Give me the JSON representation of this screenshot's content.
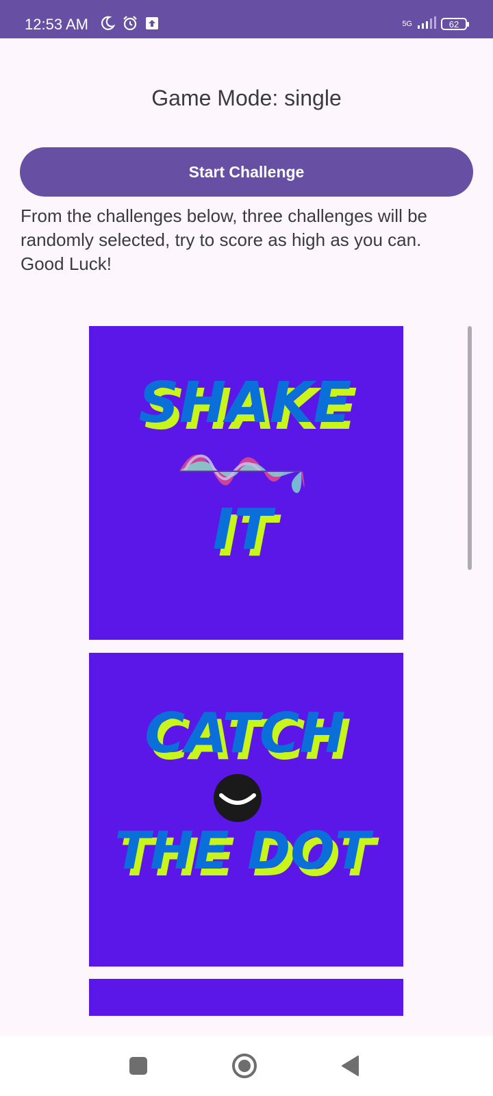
{
  "status_bar": {
    "time": "12:53 AM",
    "network": "5G",
    "battery": "62",
    "icons": [
      "moon-icon",
      "alarm-icon",
      "upload-icon",
      "signal-icon",
      "battery-icon"
    ]
  },
  "game_mode_text": "Game Mode: single",
  "start_button_label": "Start Challenge",
  "instructions": {
    "line1": "From the challenges below, three challenges will be randomly selected, try to score as high as you can.",
    "line2": "Good Luck!"
  },
  "challenges": [
    {
      "line1": "SHAKE",
      "line2": "IT"
    },
    {
      "line1": "CATCH",
      "line2": "THE DOT"
    }
  ],
  "colors": {
    "primary": "#6750a4",
    "card_bg": "#5b17e8",
    "title_blue": "#0a6fd8",
    "title_shadow": "#c8f51a",
    "page_bg": "#fdf7fd"
  },
  "nav_bar": {
    "icons": [
      "recents-square-icon",
      "home-circle-icon",
      "back-triangle-icon"
    ]
  }
}
